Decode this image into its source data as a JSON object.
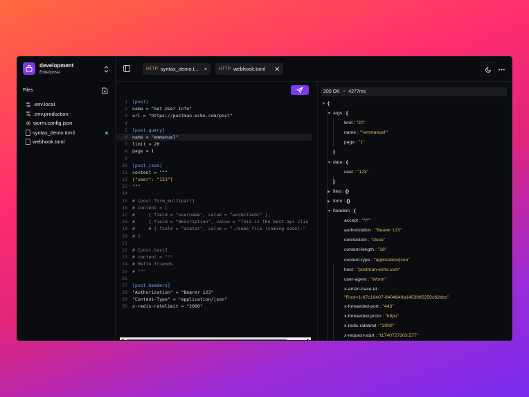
{
  "workspace": {
    "name": "development",
    "subtitle": "Enterprise"
  },
  "sidebar": {
    "files_label": "Files",
    "files": [
      {
        "name": ".env.local",
        "icon": "sliders-icon",
        "modified": false
      },
      {
        "name": ".env.production",
        "icon": "sliders-icon",
        "modified": false
      },
      {
        "name": "worm.config.json",
        "icon": "gear-icon",
        "modified": false
      },
      {
        "name": "syntax_demo.toml",
        "icon": "file-icon",
        "modified": true
      },
      {
        "name": "webhook.toml",
        "icon": "file-icon",
        "modified": false
      }
    ]
  },
  "tabs": [
    {
      "method": "HTTP",
      "name": "syntax_demo.t..."
    },
    {
      "method": "HTTP",
      "name": "webhook.toml"
    }
  ],
  "editor": {
    "lines": [
      {
        "n": "1",
        "t": "[post]",
        "c": "sec"
      },
      {
        "n": "2",
        "t": "name = \"Get User Info\"",
        "c": "kv"
      },
      {
        "n": "3",
        "t": "url = \"https://postman-echo.com/post\"",
        "c": "kv"
      },
      {
        "n": "4",
        "t": "",
        "c": ""
      },
      {
        "n": "5",
        "t": "[post.query]",
        "c": "sec"
      },
      {
        "n": "6",
        "t": "name = \"emmanuel\"",
        "c": "kv",
        "hl": true
      },
      {
        "n": "7",
        "t": "limit = 20",
        "c": "kv"
      },
      {
        "n": "8",
        "t": "page = 1",
        "c": "kv"
      },
      {
        "n": "9",
        "t": "",
        "c": ""
      },
      {
        "n": "10",
        "t": "[post.json]",
        "c": "sec"
      },
      {
        "n": "11",
        "t": "content = \"\"\"",
        "c": "kv"
      },
      {
        "n": "12",
        "t": "{\"user\": \"123\"}",
        "c": "str"
      },
      {
        "n": "13",
        "t": "\"\"\"",
        "c": "str"
      },
      {
        "n": "14",
        "t": "",
        "c": ""
      },
      {
        "n": "15",
        "t": "# [post.form_multipart]",
        "c": "com"
      },
      {
        "n": "16",
        "t": "# content = [",
        "c": "com"
      },
      {
        "n": "17",
        "t": "#     { field = \"username\", value = \"wormclient\" },",
        "c": "com"
      },
      {
        "n": "18",
        "t": "#     { field = \"description\", value = \"This is the best api clie",
        "c": "com"
      },
      {
        "n": "19",
        "t": "#     # { field = \"avatar\", value = \"./some_file (coming soon).\"",
        "c": "com"
      },
      {
        "n": "20",
        "t": "# ]",
        "c": "com"
      },
      {
        "n": "21",
        "t": "",
        "c": ""
      },
      {
        "n": "22",
        "t": "# [post.text]",
        "c": "com"
      },
      {
        "n": "23",
        "t": "# content = \"\"\"",
        "c": "com"
      },
      {
        "n": "24",
        "t": "# Hello friends",
        "c": "com"
      },
      {
        "n": "25",
        "t": "# \"\"\"",
        "c": "com"
      },
      {
        "n": "26",
        "t": "",
        "c": ""
      },
      {
        "n": "27",
        "t": "[post.headers]",
        "c": "sec"
      },
      {
        "n": "28",
        "t": "\"Authorization\" = \"Bearer 123\"",
        "c": "kv"
      },
      {
        "n": "29",
        "t": "\"Content-Type\" = \"application/json\"",
        "c": "kv"
      },
      {
        "n": "30",
        "t": "x-redis-ratelimit = \"2000\"",
        "c": "kv"
      }
    ]
  },
  "response": {
    "status": "200 OK",
    "time": "4277ms",
    "rows": [
      {
        "d": 0,
        "tw": "▼",
        "k": "",
        "v": "",
        "p": "{"
      },
      {
        "d": 1,
        "tw": "▼",
        "k": "args",
        "v": "",
        "p": "{"
      },
      {
        "d": 2,
        "tw": "",
        "k": "limit",
        "v": "\"20\"",
        "p": ""
      },
      {
        "d": 2,
        "tw": "",
        "k": "name",
        "v": "\"\"emmanuel\"\"",
        "p": ""
      },
      {
        "d": 2,
        "tw": "",
        "k": "page",
        "v": "\"1\"",
        "p": ""
      },
      {
        "d": 1,
        "tw": "",
        "k": "",
        "v": "",
        "p": "}"
      },
      {
        "d": 1,
        "tw": "▼",
        "k": "data",
        "v": "",
        "p": "{"
      },
      {
        "d": 2,
        "tw": "",
        "k": "user",
        "v": "\"123\"",
        "p": ""
      },
      {
        "d": 1,
        "tw": "",
        "k": "",
        "v": "",
        "p": "}"
      },
      {
        "d": 1,
        "tw": "▶",
        "k": "files",
        "v": "",
        "p": "{}"
      },
      {
        "d": 1,
        "tw": "▶",
        "k": "form",
        "v": "",
        "p": "{}"
      },
      {
        "d": 1,
        "tw": "▼",
        "k": "headers",
        "v": "",
        "p": "{"
      },
      {
        "d": 2,
        "tw": "",
        "k": "accept",
        "v": "\"*/*\"",
        "p": ""
      },
      {
        "d": 2,
        "tw": "",
        "k": "authorization",
        "v": "\"Bearer 123\"",
        "p": ""
      },
      {
        "d": 2,
        "tw": "",
        "k": "connection",
        "v": "\"close\"",
        "p": ""
      },
      {
        "d": 2,
        "tw": "",
        "k": "content-length",
        "v": "\"16\"",
        "p": ""
      },
      {
        "d": 2,
        "tw": "",
        "k": "content-type",
        "v": "\"application/json\"",
        "p": ""
      },
      {
        "d": 2,
        "tw": "",
        "k": "host",
        "v": "\"postman-echo.com\"",
        "p": ""
      },
      {
        "d": 2,
        "tw": "",
        "k": "user-agent",
        "v": "\"Worm\"",
        "p": ""
      },
      {
        "d": 2,
        "tw": "",
        "k": "x-amzn-trace-id",
        "v": "",
        "p": ""
      },
      {
        "d": 2,
        "tw": "",
        "k": "",
        "v": "\"Root=1-67c16407-0404649a1453065250c62bbc\"",
        "p": "",
        "cont": true
      },
      {
        "d": 2,
        "tw": "",
        "k": "x-forwarded-port",
        "v": "\"443\"",
        "p": ""
      },
      {
        "d": 2,
        "tw": "",
        "k": "x-forwarded-proto",
        "v": "\"https\"",
        "p": ""
      },
      {
        "d": 2,
        "tw": "",
        "k": "x-redis-ratelimit",
        "v": "\"2000\"",
        "p": ""
      },
      {
        "d": 2,
        "tw": "",
        "k": "x-request-start",
        "v": "\"t1740727303.577\"",
        "p": ""
      }
    ]
  },
  "colors": {
    "accent": "#7c3aed",
    "background": "#0b0c10",
    "modified_dot": "#22c55e"
  }
}
